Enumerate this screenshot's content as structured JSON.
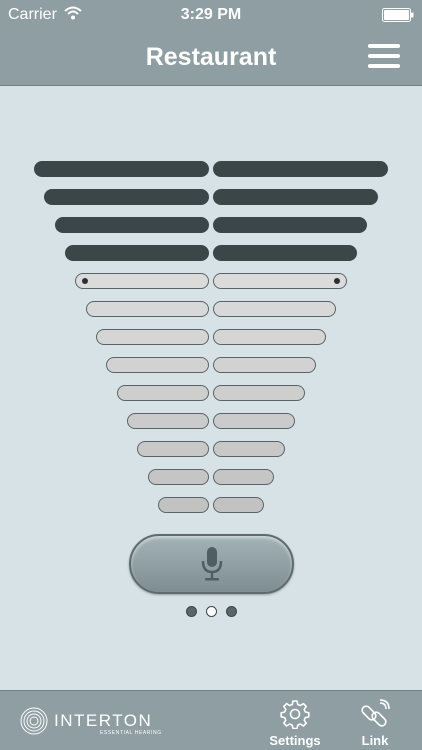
{
  "status_bar": {
    "carrier": "Carrier",
    "time": "3:29 PM"
  },
  "nav": {
    "title": "Restaurant"
  },
  "volume": {
    "levels_total": 13,
    "active_levels": 4,
    "marker_row": 5
  },
  "page_indicator": {
    "pages": 3,
    "current": 2
  },
  "brand": {
    "name": "INTERTON",
    "tagline": "ESSENTIAL HEARING"
  },
  "tabs": [
    {
      "label": "Settings",
      "icon": "gear-icon"
    },
    {
      "label": "Link",
      "icon": "link-icon"
    }
  ],
  "colors": {
    "bar_background": "#8e9ea3",
    "content_background": "#d7e2e6",
    "active_level": "#3b4648",
    "inactive_level": "#e6e6e6"
  }
}
